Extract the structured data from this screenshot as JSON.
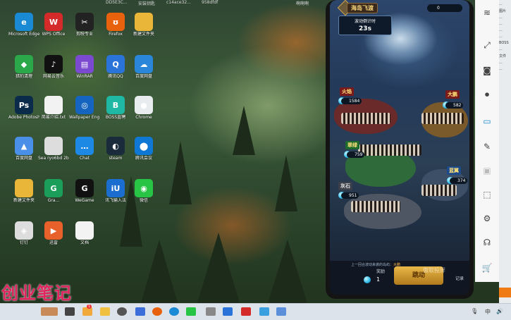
{
  "top_strip": [
    "DD5E3C...",
    "安装钥匙",
    "c14ace32...",
    "958dfdf",
    "啊啊啊"
  ],
  "desktop_icons": [
    {
      "label": "Microsoft Edge",
      "icon": "edge-icon",
      "color": "#1a8ad4",
      "glyph": "e"
    },
    {
      "label": "WPS Office",
      "icon": "wps-icon",
      "color": "#d42a2a",
      "glyph": "W"
    },
    {
      "label": "剪映专业",
      "icon": "capcut-icon",
      "color": "#222",
      "glyph": "✂"
    },
    {
      "label": "Firefox",
      "icon": "firefox-icon",
      "color": "#e8620d",
      "glyph": "ʊ"
    },
    {
      "label": "新建文件夹",
      "icon": "folder-icon",
      "color": "#e9b63a",
      "glyph": ""
    },
    {
      "label": "猎豹清理",
      "icon": "cleaner-icon",
      "color": "#2aa84a",
      "glyph": "◆"
    },
    {
      "label": "网易云音乐",
      "icon": "music-icon",
      "color": "#111",
      "glyph": "♪"
    },
    {
      "label": "WinRAR",
      "icon": "archive-icon",
      "color": "#7b4ad1",
      "glyph": "▤"
    },
    {
      "label": "腾讯QQ",
      "icon": "qq-icon",
      "color": "#2a73d9",
      "glyph": "Q"
    },
    {
      "label": "百度网盘",
      "icon": "cloud-icon",
      "color": "#2a86d9",
      "glyph": "☁"
    },
    {
      "label": "Adobe Photosh...",
      "icon": "photoshop-icon",
      "color": "#0a2b4a",
      "glyph": "Ps"
    },
    {
      "label": "简易介绍.txt",
      "icon": "text-file-icon",
      "color": "#f2f2f2",
      "glyph": ""
    },
    {
      "label": "Wallpaper Engine",
      "icon": "wallpaper-engine-icon",
      "color": "#1565c0",
      "glyph": "◎"
    },
    {
      "label": "BOSS直聘",
      "icon": "boss-icon",
      "color": "#1fb8a4",
      "glyph": "B"
    },
    {
      "label": "Chrome",
      "icon": "chrome-icon",
      "color": "#e8ecef",
      "glyph": "●"
    },
    {
      "label": "百度网盘",
      "icon": "baidu-disk-icon",
      "color": "#4a8fe8",
      "glyph": "▲"
    },
    {
      "label": "Sea ryo6bd 2bc2bb4",
      "icon": "image-file-icon",
      "color": "#ddd",
      "glyph": ""
    },
    {
      "label": "Chat",
      "icon": "chat-icon",
      "color": "#1e88e5",
      "glyph": "…"
    },
    {
      "label": "steam",
      "icon": "steam-icon",
      "color": "#1a2b3c",
      "glyph": "◐"
    },
    {
      "label": "腾讯会议",
      "icon": "meeting-icon",
      "color": "#0f77d4",
      "glyph": "⬤"
    },
    {
      "label": "新建文件夹",
      "icon": "folder-icon-2",
      "color": "#e9b63a",
      "glyph": ""
    },
    {
      "label": "Gra...",
      "icon": "green-app-icon",
      "color": "#1b9e59",
      "glyph": "G"
    },
    {
      "label": "WeGame",
      "icon": "wegame-icon",
      "color": "#111",
      "glyph": "G"
    },
    {
      "label": "讯飞输入法",
      "icon": "xunfei-icon",
      "color": "#1c6dd0",
      "glyph": "iU"
    },
    {
      "label": "微信",
      "icon": "wechat-icon",
      "color": "#28c445",
      "glyph": "◉"
    },
    {
      "label": "钉钉",
      "icon": "dingtalk-icon",
      "color": "#ddd",
      "glyph": "◈"
    },
    {
      "label": "迅雷",
      "icon": "thunder-icon",
      "color": "#e8602a",
      "glyph": "▶"
    },
    {
      "label": "文档",
      "icon": "doc-icon",
      "color": "#f3f3f3",
      "glyph": ""
    }
  ],
  "watermark": "创业笔记",
  "game": {
    "title": "海岛飞渡",
    "countdown_label": "波动倒计时",
    "countdown_value": "23s",
    "score": "0",
    "teams": [
      {
        "name": "火焰",
        "count": "1584"
      },
      {
        "name": "大鹏",
        "count": "582"
      },
      {
        "name": "翠绿",
        "count": "759"
      },
      {
        "name": "蓝翼",
        "count": "374"
      },
      {
        "name": "灰石",
        "count": "951"
      }
    ],
    "hint_text": "上一回合波动来袭的岛屿：",
    "hint_highlight": "大鹏",
    "bet_label": "奖励",
    "bet_value": "1",
    "bet_button": "跳动",
    "record_label": "记录",
    "projection_watermark": "傲软投屏"
  },
  "toolbar": {
    "active_button": "screen-mirror"
  },
  "right_panel_texts": [
    "...",
    "图片",
    "...",
    "...",
    "...",
    "...",
    "BOSS",
    "...",
    "文件",
    "...",
    "..."
  ],
  "taskbar": {
    "tray_text": "中",
    "notification_count": "1"
  }
}
